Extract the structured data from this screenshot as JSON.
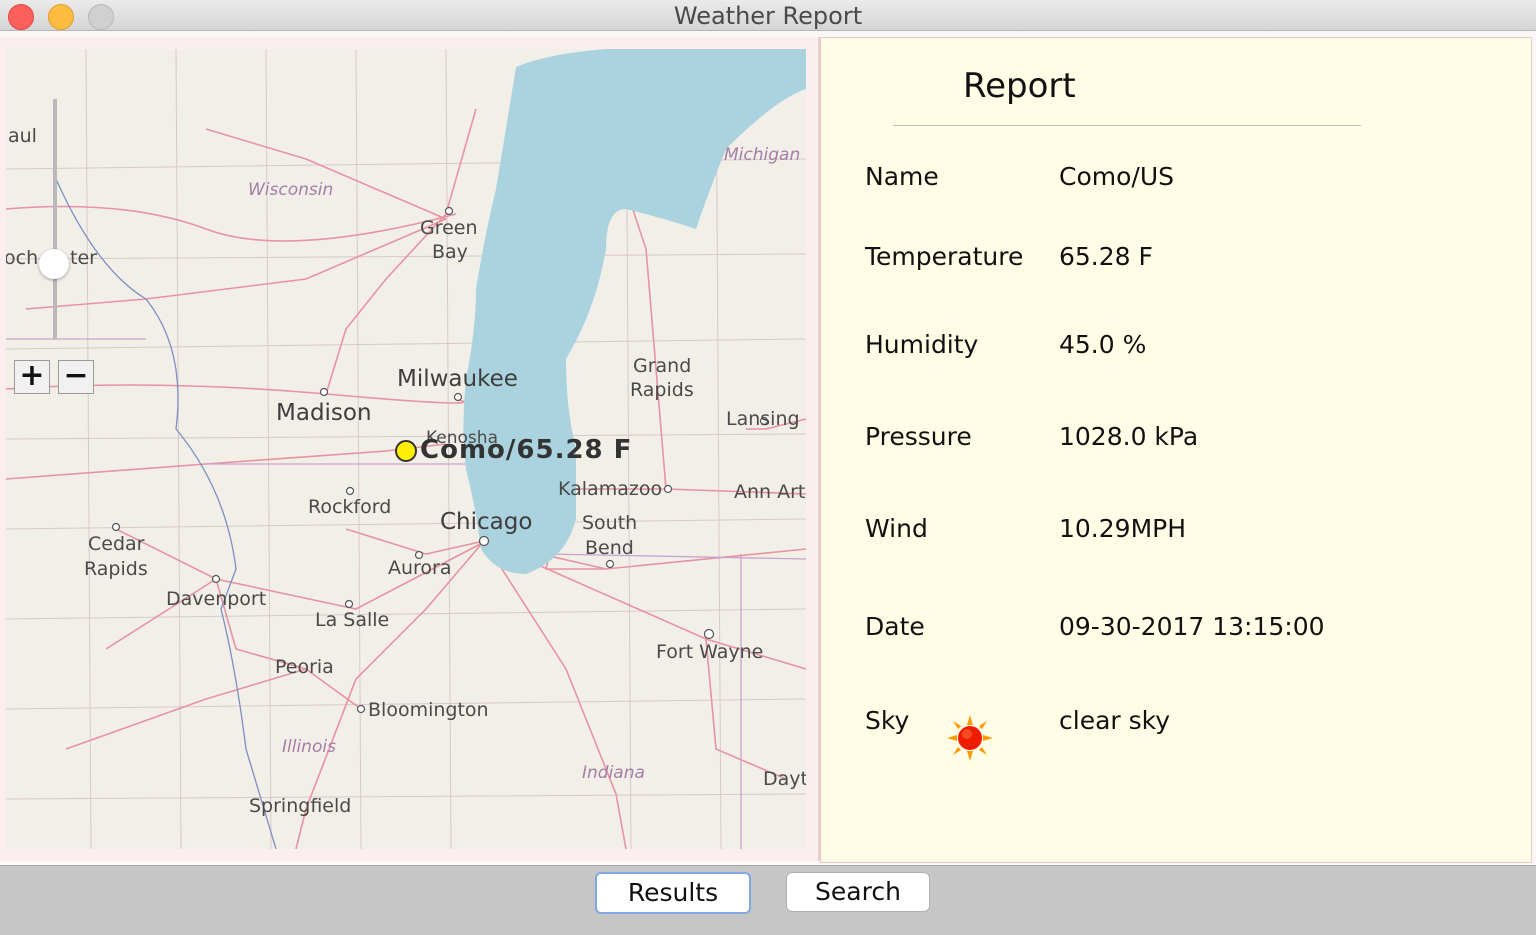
{
  "window": {
    "title": "Weather Report"
  },
  "map": {
    "labels": {
      "saint_paul_partial": "aul",
      "rochester_partial": "och",
      "rochester_partial2": "ter",
      "wisconsin": "Wisconsin",
      "michigan": "Michigan",
      "green_bay_1": "Green",
      "green_bay_2": "Bay",
      "milwaukee": "Milwaukee",
      "madison": "Madison",
      "kenosha": "Kenosha",
      "grand_rapids_1": "Grand",
      "grand_rapids_2": "Rapids",
      "lansing": "Lansing",
      "kalamazoo": "Kalamazoo",
      "ann_arbor": "Ann Art",
      "rockford": "Rockford",
      "chicago": "Chicago",
      "south_bend_1": "South",
      "south_bend_2": "Bend",
      "cedar_rapids_1": "Cedar",
      "cedar_rapids_2": "Rapids",
      "aurora": "Aurora",
      "davenport": "Davenport",
      "la_salle": "La Salle",
      "fort_wayne": "Fort Wayne",
      "peoria": "Peoria",
      "bloomington": "Bloomington",
      "illinois": "Illinois",
      "indiana": "Indiana",
      "dayton": "Dayt",
      "springfield": "Springfield"
    },
    "zoom_in": "+",
    "zoom_out": "−",
    "marker_label": "Como/65.28 F"
  },
  "report": {
    "title": "Report",
    "rows": [
      {
        "label": "Name",
        "value": "Como/US"
      },
      {
        "label": "Temperature",
        "value": "65.28 F"
      },
      {
        "label": "Humidity",
        "value": "45.0 %"
      },
      {
        "label": "Pressure",
        "value": "1028.0 kPa"
      },
      {
        "label": "Wind",
        "value": "10.29MPH"
      },
      {
        "label": "Date",
        "value": "09-30-2017 13:15:00"
      },
      {
        "label": "Sky",
        "value": "clear sky",
        "icon": "sun-icon"
      }
    ]
  },
  "buttons": {
    "results": "Results",
    "search": "Search"
  },
  "colors": {
    "report_bg": "#fffde6",
    "lake": "#abd3df",
    "road": "#e892a2",
    "button_focus": "#7fa9e3"
  }
}
